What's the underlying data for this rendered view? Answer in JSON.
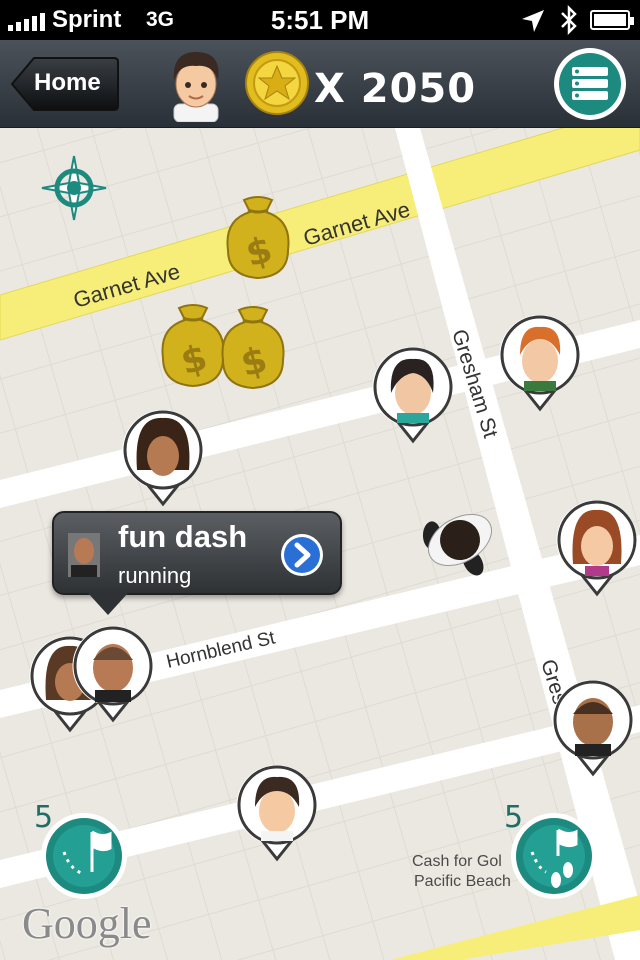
{
  "status_bar": {
    "carrier": "Sprint",
    "network": "3G",
    "time": "5:51 PM"
  },
  "header": {
    "home_label": "Home",
    "coin_count": "X 2050"
  },
  "map": {
    "streets": {
      "garnet_ave": "Garnet Ave",
      "gresham_st": "Gresham St",
      "gresham_st_lower": "Gres",
      "hornblend_st": "Hornblend St"
    },
    "place": {
      "line1": "Cash for Gol",
      "line2": "Pacific Beach"
    },
    "attribution": "Google"
  },
  "callout": {
    "title": "fun dash",
    "subtitle": "running"
  },
  "left_flag_count": "5",
  "right_flag_count": "5",
  "colors": {
    "teal": "#1d8a80",
    "road_yellow": "#f6ee78",
    "map_bg": "#ebe8e1",
    "gold": "#d4b52a"
  }
}
